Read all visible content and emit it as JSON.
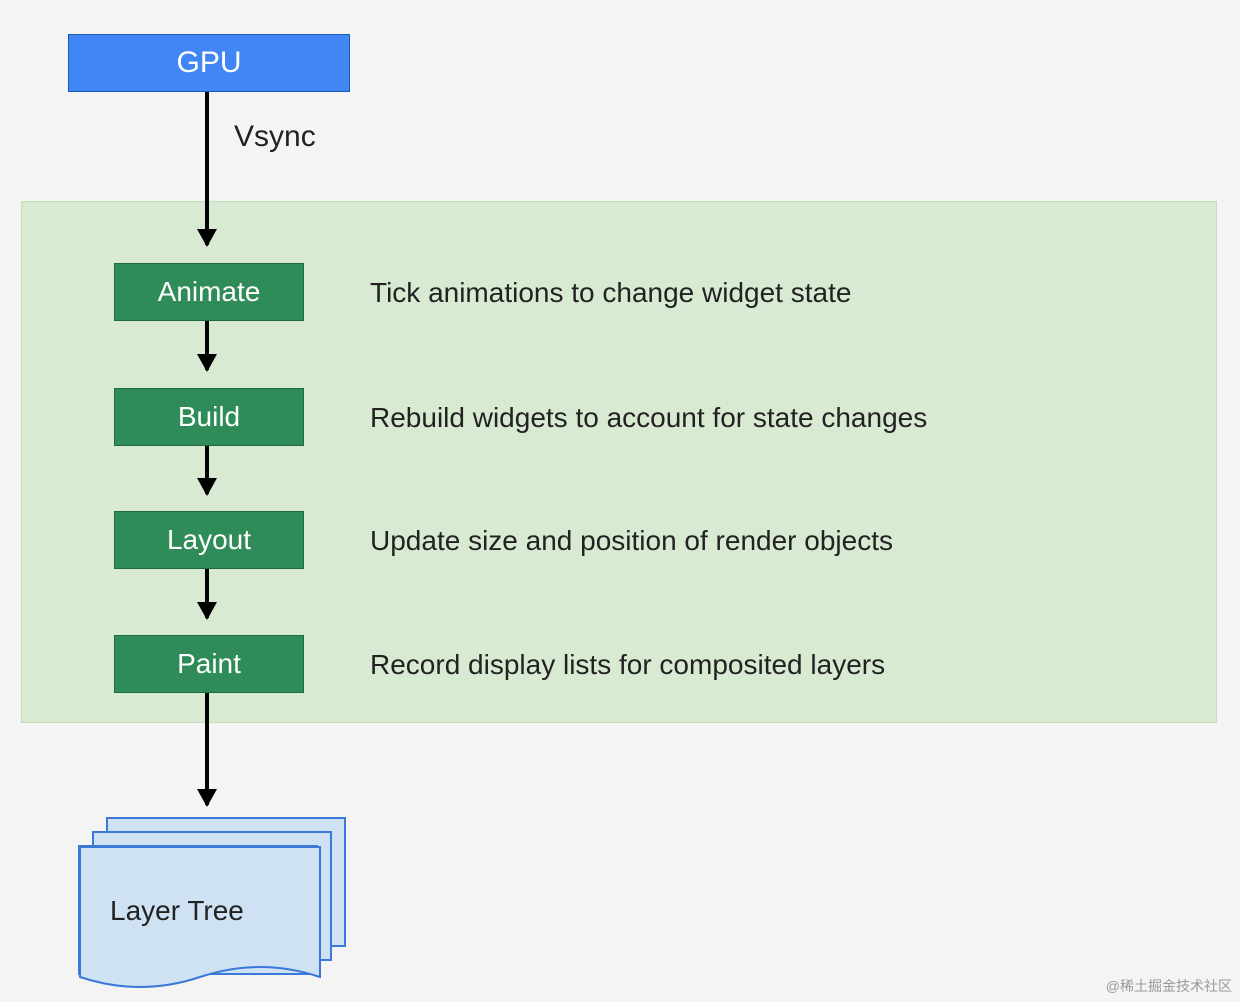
{
  "nodes": {
    "gpu": "GPU",
    "animate": "Animate",
    "build": "Build",
    "layout": "Layout",
    "paint": "Paint",
    "layer_tree": "Layer Tree"
  },
  "edge_labels": {
    "vsync": "Vsync"
  },
  "descriptions": {
    "animate": "Tick animations to change widget state",
    "build": "Rebuild widgets to account for state changes",
    "layout": "Update size and position of render objects",
    "paint": "Record display lists for composited layers"
  },
  "colors": {
    "gpu_bg": "#4285f4",
    "stage_bg": "#2f8b57",
    "panel_bg": "#d9ead3",
    "layer_bg": "#cfe2f3",
    "layer_border": "#3c78d8"
  },
  "watermark": "@稀土掘金技术社区"
}
